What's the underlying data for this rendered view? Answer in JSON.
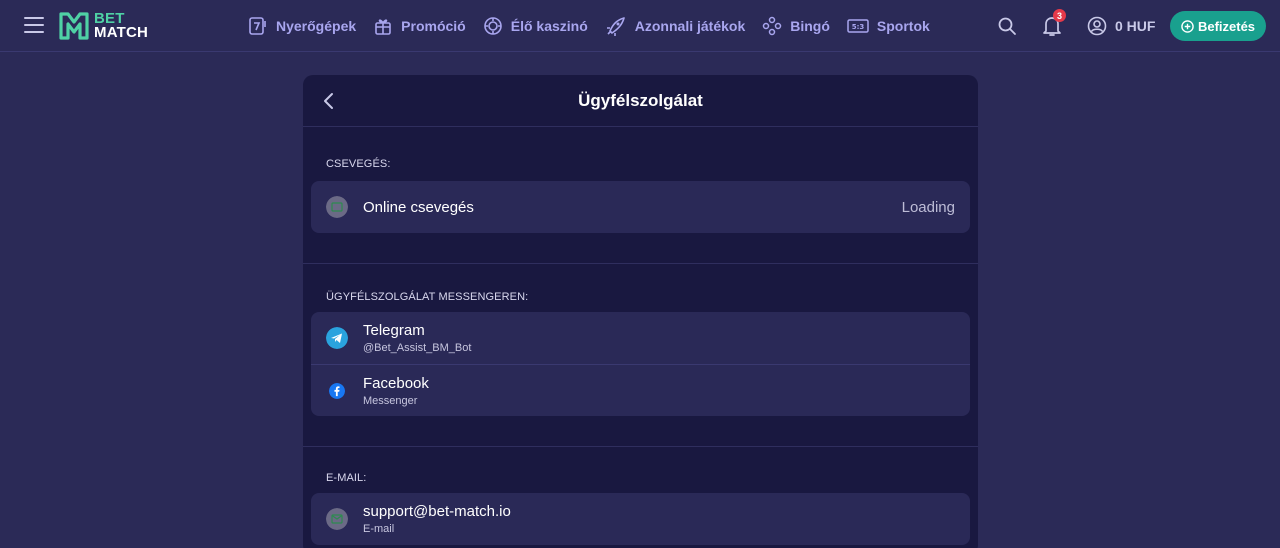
{
  "header": {
    "logo_line1": "BET",
    "logo_line2": "MATCH",
    "nav": [
      {
        "label": "Nyerőgépek",
        "icon": "slot-icon"
      },
      {
        "label": "Promóció",
        "icon": "gift-icon"
      },
      {
        "label": "Élő kaszinó",
        "icon": "chip-icon"
      },
      {
        "label": "Azonnali játékok",
        "icon": "rocket-icon"
      },
      {
        "label": "Bingó",
        "icon": "bingo-icon"
      },
      {
        "label": "Sportok",
        "icon": "scoreboard-icon"
      }
    ],
    "notification_count": "3",
    "balance": "0 HUF",
    "deposit_label": "Befizetés"
  },
  "modal": {
    "title": "Ügyfélszolgálat",
    "chat_section": {
      "label": "CSEVEGÉS:",
      "items": [
        {
          "title": "Online csevegés",
          "status": "Loading"
        }
      ]
    },
    "messenger_section": {
      "label": "ÜGYFÉLSZOLGÁLAT MESSENGEREN:",
      "items": [
        {
          "title": "Telegram",
          "subtitle": "@Bet_Assist_BM_Bot"
        },
        {
          "title": "Facebook",
          "subtitle": "Messenger"
        }
      ]
    },
    "email_section": {
      "label": "E-MAIL:",
      "items": [
        {
          "title": "support@bet-match.io",
          "subtitle": "E-mail"
        }
      ]
    }
  },
  "colors": {
    "background": "#2b2a57",
    "modal": "#191840",
    "card": "#2a2957",
    "accent_green": "#4fd1a5",
    "deposit": "#19a08e",
    "nav_text": "#a9a6ef",
    "badge": "#e5394a"
  }
}
